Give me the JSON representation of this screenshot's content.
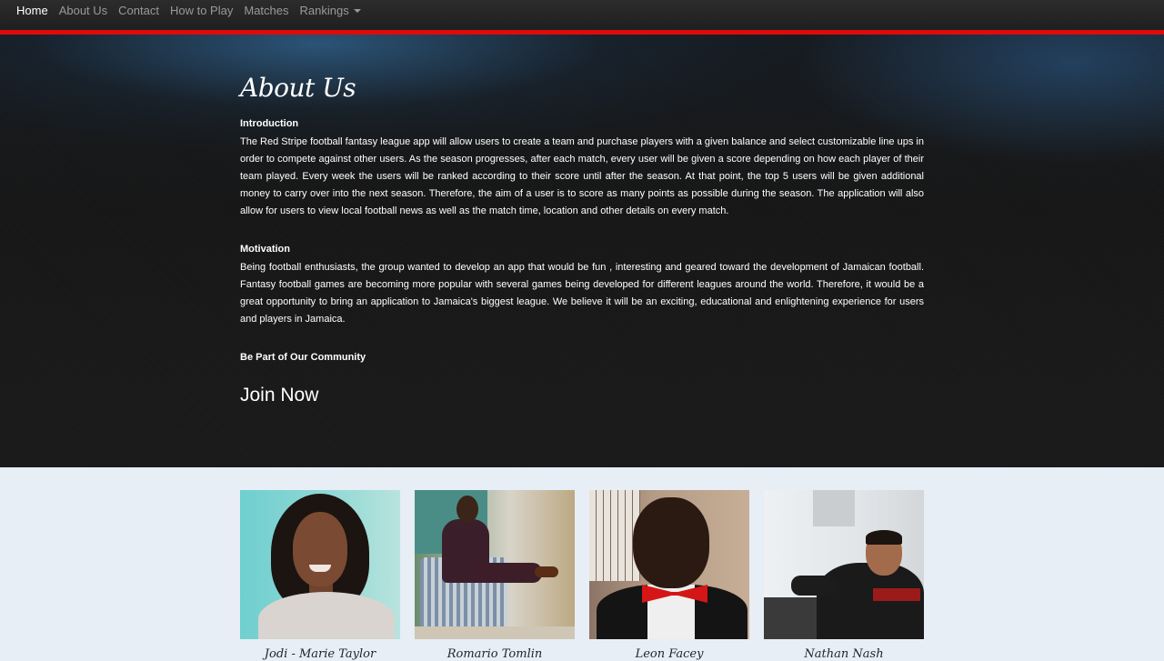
{
  "nav": {
    "items": [
      {
        "label": "Home",
        "active": true
      },
      {
        "label": "About Us",
        "active": false
      },
      {
        "label": "Contact",
        "active": false
      },
      {
        "label": "How to Play",
        "active": false
      },
      {
        "label": "Matches",
        "active": false
      },
      {
        "label": "Rankings",
        "active": false,
        "dropdown": true
      }
    ]
  },
  "hero": {
    "title": "About Us",
    "sections": [
      {
        "heading": "Introduction",
        "text": "The Red Stripe football fantasy league app will allow users to create a team and purchase players with a given balance and select customizable line ups in order to compete against other users. As the season progresses, after each match, every user will be given a score depending on how each player of their team played. Every week the users will be ranked according to their score until after the season. At that point, the top 5 users will be given additional money to carry over into the next season. Therefore, the aim of a user is to score as many points as possible during the season. The application will also allow for users to view local football news as well as the match time, location and other details on every match."
      },
      {
        "heading": "Motivation",
        "text": "Being football enthusiasts, the group wanted to develop an app that would be fun , interesting and geared toward the development of Jamaican football. Fantasy football games are becoming more popular with several games being developed for different leagues around the world. Therefore, it would be a great opportunity to bring an application to Jamaica's biggest league. We believe it will be an exciting, educational and enlightening experience for users and players in Jamaica."
      }
    ],
    "community_heading": "Be Part of Our Community",
    "join_label": "Join Now"
  },
  "team": {
    "members": [
      {
        "name": "Jodi - Marie Taylor"
      },
      {
        "name": "Romario Tomlin"
      },
      {
        "name": "Leon Facey"
      },
      {
        "name": "Nathan Nash"
      }
    ]
  },
  "colors": {
    "accent": "#e10a0a",
    "nav_bg": "#222222",
    "page_bg": "#e7eef5",
    "hero_bg": "#161616"
  }
}
